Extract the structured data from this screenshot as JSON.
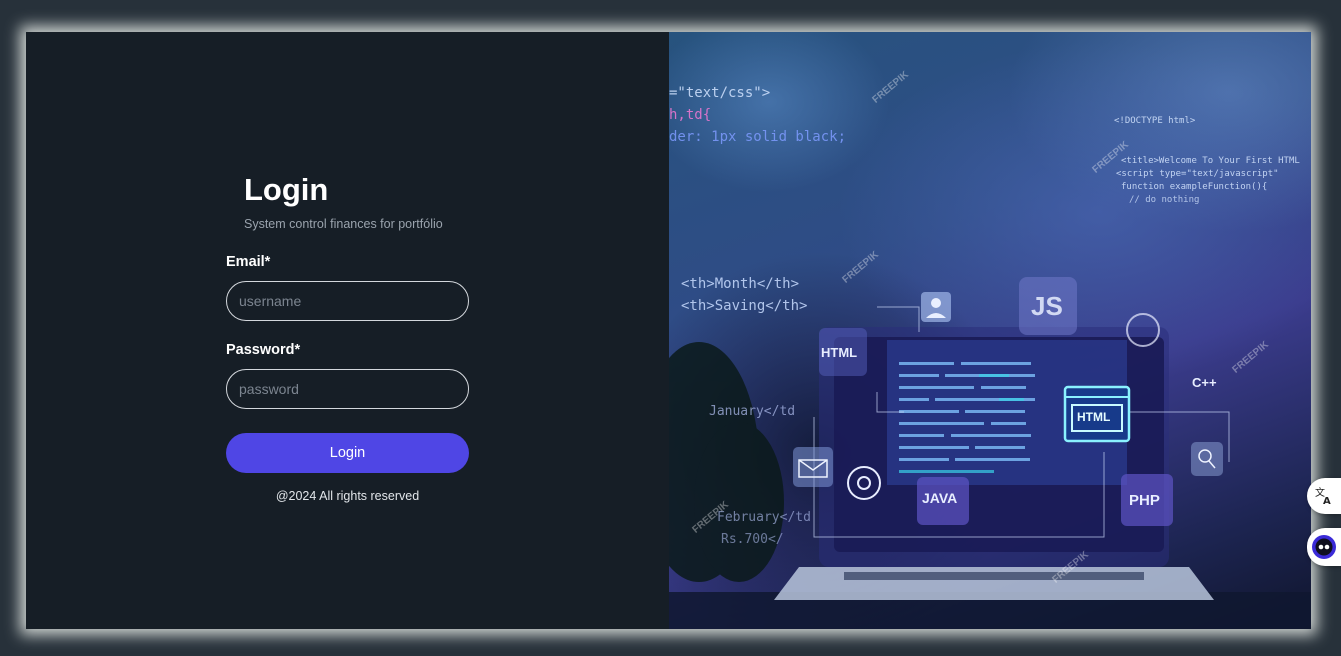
{
  "login": {
    "title": "Login",
    "subtitle": "System control finances for portfólio",
    "email_label": "Email*",
    "email_placeholder": "username",
    "password_label": "Password*",
    "password_placeholder": "password",
    "submit_label": "Login",
    "footer": "@2024 All rights reserved"
  },
  "illustration": {
    "code_lines": [
      "=\"text/css\">",
      "h,td{",
      "der: 1px solid black;",
      "<th>Month</th>",
      "<th>Saving</th>",
      "January</td",
      "February</td",
      "Rs.700</"
    ],
    "right_code_lines": [
      "<!DOCTYPE html>",
      "<title>Welcome To Your First HTML",
      "<script type=\"text/javascript\"",
      "function exampleFunction(){",
      "// do nothing"
    ],
    "tags": {
      "html": "HTML",
      "js": "JS",
      "cpp": "C++",
      "java": "JAVA",
      "php": "PHP",
      "screen_html": "HTML"
    },
    "watermark": "FREEPIK"
  },
  "colors": {
    "background": "#161e26",
    "accent": "#4f46e5",
    "outer": "#27313a"
  },
  "floating_widgets": {
    "translate_icon": "translate-icon",
    "assistant_icon": "assistant-icon"
  }
}
